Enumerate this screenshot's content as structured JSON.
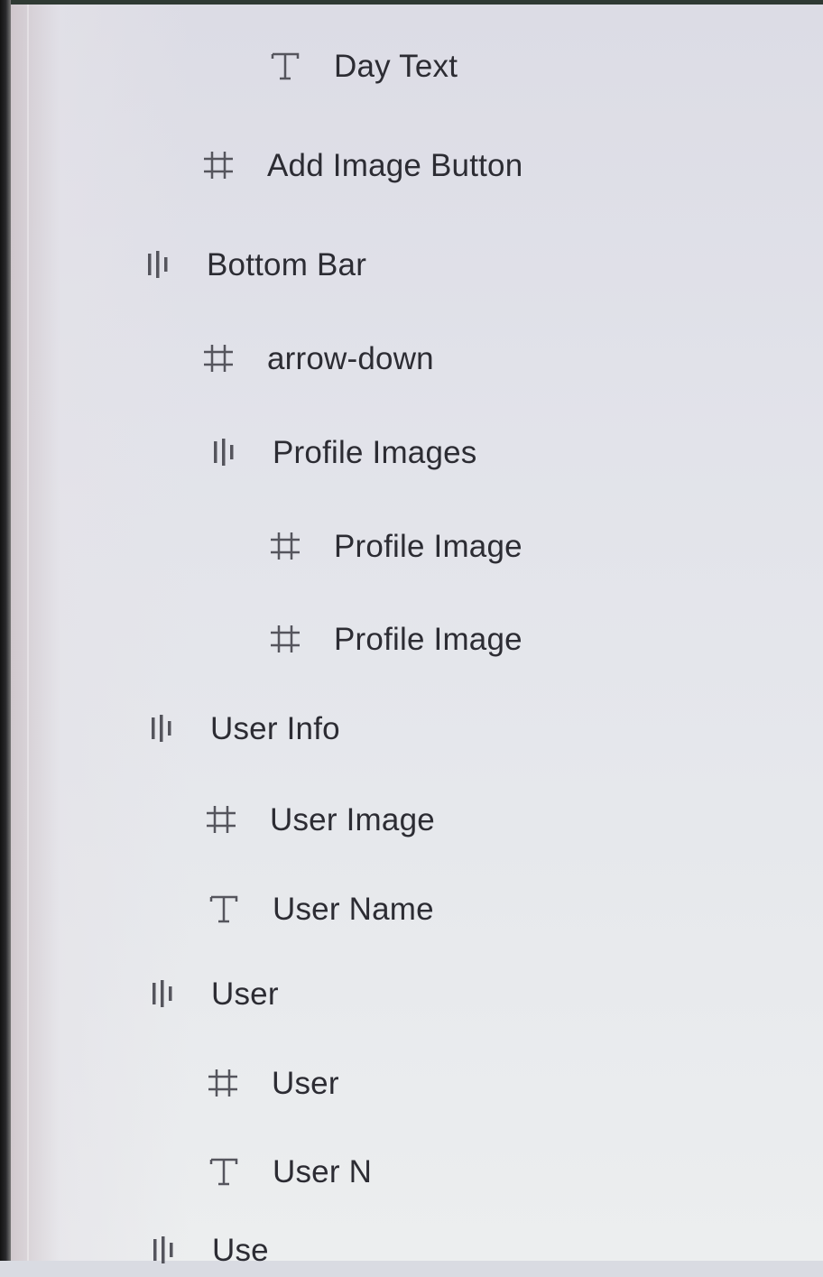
{
  "layers_panel": {
    "rows": [
      {
        "label": "Day Text",
        "icon": "text-icon"
      },
      {
        "label": "Add Image Button",
        "icon": "frame-icon"
      },
      {
        "label": "Bottom Bar",
        "icon": "auto-layout-icon"
      },
      {
        "label": "arrow-down",
        "icon": "frame-icon"
      },
      {
        "label": "Profile Images",
        "icon": "auto-layout-icon"
      },
      {
        "label": "Profile Image",
        "icon": "frame-icon"
      },
      {
        "label": "Profile Image",
        "icon": "frame-icon"
      },
      {
        "label": "User Info",
        "icon": "auto-layout-icon"
      },
      {
        "label": "User Image",
        "icon": "frame-icon"
      },
      {
        "label": "User Name",
        "icon": "text-icon"
      },
      {
        "label": "User",
        "icon": "auto-layout-icon"
      },
      {
        "label": "User",
        "icon": "frame-icon"
      },
      {
        "label": "User N",
        "icon": "text-icon"
      },
      {
        "label": "Use",
        "icon": "auto-layout-icon"
      }
    ]
  },
  "colors": {
    "text": "#2c2c33",
    "icon": "#55555d",
    "panel_background": "#e4e5eb"
  }
}
